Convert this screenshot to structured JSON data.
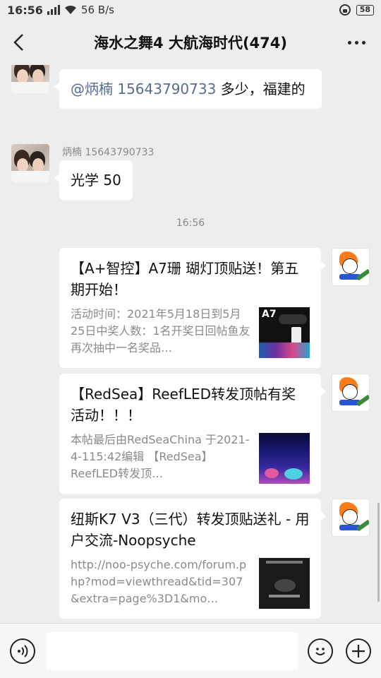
{
  "status_bar": {
    "time": "16:56",
    "network": "3G",
    "speed": "56 B/s",
    "battery": "58"
  },
  "header": {
    "title": "海水之舞4 大航海时代(474)"
  },
  "messages": [
    {
      "type": "text",
      "side": "left",
      "sender": "",
      "mention": "@炳楠 15643790733",
      "text": " 多少，福建的"
    },
    {
      "type": "text",
      "side": "left",
      "sender": "炳楠 15643790733",
      "text": "光学 50"
    }
  ],
  "timestamp": "16:56",
  "cards": [
    {
      "title": "【A+智控】A7珊 瑚灯顶贴送！第五期开始！",
      "desc": "活动时间：2021年5月18日到5月25日中奖人数：1名开奖日回帖鱼友再次抽中一名奖品…",
      "thumb_label": "A7"
    },
    {
      "title": "【RedSea】ReefLED转发顶帖有奖活动！！！",
      "desc": "本帖最后由RedSeaChina 于2021-4-115:42编辑 【RedSea】ReefLED转发顶…"
    },
    {
      "title": "纽斯K7 V3（三代）转发顶贴送礼 - 用户交流-Noopsyche",
      "desc": "http://noo-psyche.com/forum.php?mod=viewthread&tid=307&extra=page%3D1&mo…"
    }
  ],
  "input": {
    "placeholder": ""
  }
}
